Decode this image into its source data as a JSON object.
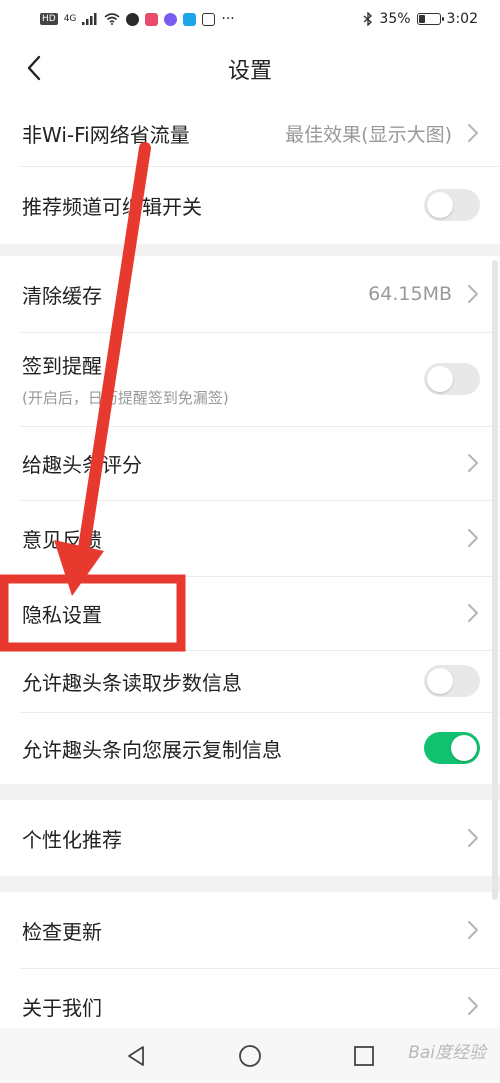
{
  "status_bar": {
    "chips": [
      "HD",
      "4G"
    ],
    "battery_percent": "35%",
    "battery_level": 0.35,
    "time": "3:02",
    "more": "···"
  },
  "nav": {
    "title": "设置"
  },
  "groups": [
    {
      "rows": [
        {
          "name": "row-data-saving",
          "label": "非Wi-Fi网络省流量",
          "value": "最佳效果(显示大图)",
          "kind": "chevron"
        },
        {
          "name": "row-editable-channels",
          "label": "推荐频道可编辑开关",
          "kind": "toggle",
          "on": false
        }
      ]
    },
    {
      "rows": [
        {
          "name": "row-clear-cache",
          "label": "清除缓存",
          "value": "64.15MB",
          "kind": "chevron"
        },
        {
          "name": "row-checkin-reminder",
          "label": "签到提醒",
          "sub": "(开启后，日历提醒签到免漏签)",
          "kind": "toggle",
          "on": false
        },
        {
          "name": "row-rate-app",
          "label": "给趣头条评分",
          "kind": "chevron"
        },
        {
          "name": "row-feedback",
          "label": "意见反馈",
          "kind": "chevron"
        },
        {
          "name": "row-privacy-settings",
          "label": "隐私设置",
          "kind": "chevron"
        },
        {
          "name": "row-step-count",
          "label": "允许趣头条读取步数信息",
          "kind": "toggle",
          "on": false
        },
        {
          "name": "row-clipboard-info",
          "label": "允许趣头条向您展示复制信息",
          "kind": "toggle",
          "on": true
        }
      ]
    },
    {
      "rows": [
        {
          "name": "row-personalized",
          "label": "个性化推荐",
          "kind": "chevron"
        }
      ]
    },
    {
      "rows": [
        {
          "name": "row-check-update",
          "label": "检查更新",
          "kind": "chevron"
        },
        {
          "name": "row-about-us",
          "label": "关于我们",
          "kind": "chevron"
        }
      ]
    }
  ],
  "watermark": "Bai度经验",
  "colors": {
    "toggle_on": "#12c16f",
    "annotation": "#e8392f"
  },
  "icons": {
    "back": "chevron-left-icon",
    "chevron": "chevron-right-icon",
    "nav_back": "triangle-back-icon",
    "nav_home": "circle-home-icon",
    "nav_recent": "square-recent-icon"
  }
}
